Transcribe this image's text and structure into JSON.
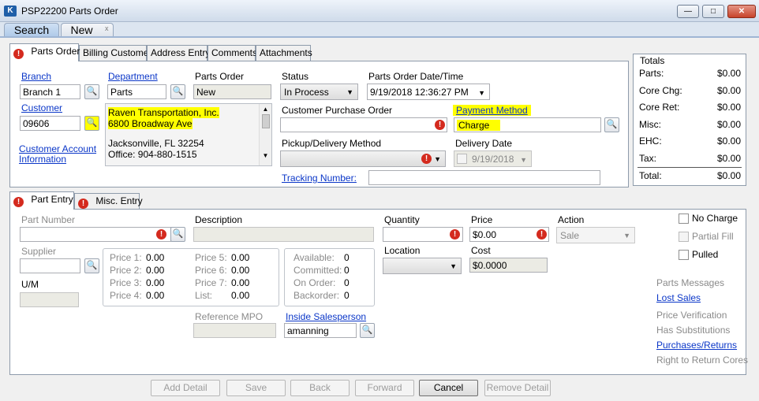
{
  "window": {
    "app_icon": "K",
    "title": "PSP22200 Parts Order",
    "controls": {
      "minimize": "—",
      "restore": "□",
      "close": "✕"
    }
  },
  "top_tabs": [
    {
      "label": "Search"
    },
    {
      "label": "New",
      "close": "x"
    }
  ],
  "order_tabs": [
    "Parts Order",
    "Billing Customer",
    "Address Entry",
    "Comments",
    "Attachments"
  ],
  "header": {
    "branch_label": "Branch",
    "branch_value": "Branch 1",
    "department_label": "Department",
    "department_value": "Parts",
    "parts_order_label": "Parts Order",
    "parts_order_value": "New",
    "customer_label": "Customer",
    "customer_value": "09606",
    "customer_account_link_line1": "Customer Account",
    "customer_account_link_line2": "Information",
    "address": {
      "line1": "Raven Transportation, Inc.",
      "line2": "6800 Broadway Ave",
      "line3": "Jacksonville, FL 32254",
      "line4": "Office: 904-880-1515"
    },
    "status_label": "Status",
    "status_value": "In Process",
    "date_label": "Parts Order Date/Time",
    "date_value": "9/19/2018 12:36:27 PM",
    "po_label": "Customer Purchase Order",
    "po_value": "",
    "payment_label": "Payment Method",
    "payment_value": "Charge",
    "pickup_label": "Pickup/Delivery Method",
    "pickup_value": "",
    "delivery_label": "Delivery Date",
    "delivery_value": "9/19/2018",
    "tracking_label": "Tracking Number:",
    "tracking_value": ""
  },
  "totals": {
    "title": "Totals",
    "rows": [
      {
        "label": "Parts:",
        "value": "$0.00"
      },
      {
        "label": "Core Chg:",
        "value": "$0.00"
      },
      {
        "label": "Core Ret:",
        "value": "$0.00"
      },
      {
        "label": "Misc:",
        "value": "$0.00"
      },
      {
        "label": "EHC:",
        "value": "$0.00"
      },
      {
        "label": "Tax:",
        "value": "$0.00"
      }
    ],
    "total_label": "Total:",
    "total_value": "$0.00"
  },
  "entry_tabs": [
    "Part Entry",
    "Misc. Entry"
  ],
  "part_entry": {
    "part_number_label": "Part Number",
    "description_label": "Description",
    "quantity_label": "Quantity",
    "price_label": "Price",
    "price_value": "$0.00",
    "action_label": "Action",
    "action_value": "Sale",
    "supplier_label": "Supplier",
    "location_label": "Location",
    "cost_label": "Cost",
    "cost_value": "$0.0000",
    "um_label": "U/M",
    "price_levels": [
      {
        "label": "Price 1:",
        "value": "0.00"
      },
      {
        "label": "Price 2:",
        "value": "0.00"
      },
      {
        "label": "Price 3:",
        "value": "0.00"
      },
      {
        "label": "Price 4:",
        "value": "0.00"
      },
      {
        "label": "Price 5:",
        "value": "0.00"
      },
      {
        "label": "Price 6:",
        "value": "0.00"
      },
      {
        "label": "Price 7:",
        "value": "0.00"
      },
      {
        "label": "List:",
        "value": "0.00"
      }
    ],
    "availability": [
      {
        "label": "Available:",
        "value": "0"
      },
      {
        "label": "Committed:",
        "value": "0"
      },
      {
        "label": "On Order:",
        "value": "0"
      },
      {
        "label": "Backorder:",
        "value": "0"
      }
    ],
    "reference_mpo_label": "Reference MPO",
    "inside_salesperson_label": "Inside Salesperson",
    "inside_salesperson_value": "amanning",
    "checkboxes": [
      {
        "label": "No Charge"
      },
      {
        "label": "Partial Fill"
      },
      {
        "label": "Pulled"
      }
    ],
    "side_links": [
      "Parts Messages",
      "Lost Sales",
      "Price Verification",
      "Has Substitutions",
      "Purchases/Returns",
      "Right to Return Cores"
    ]
  },
  "buttons": {
    "add_detail": "Add Detail",
    "save": "Save",
    "back": "Back",
    "forward": "Forward",
    "cancel": "Cancel",
    "remove_detail": "Remove Detail"
  },
  "icons": {
    "error": "!",
    "binoculars": "🔍",
    "dropdown": "▼",
    "scroll_up": "▲",
    "scroll_down": "▼"
  },
  "colors": {
    "highlight": "#ffff00",
    "link": "#0a36c8",
    "error": "#d42a1e",
    "tab_active": "#aec9e8"
  }
}
